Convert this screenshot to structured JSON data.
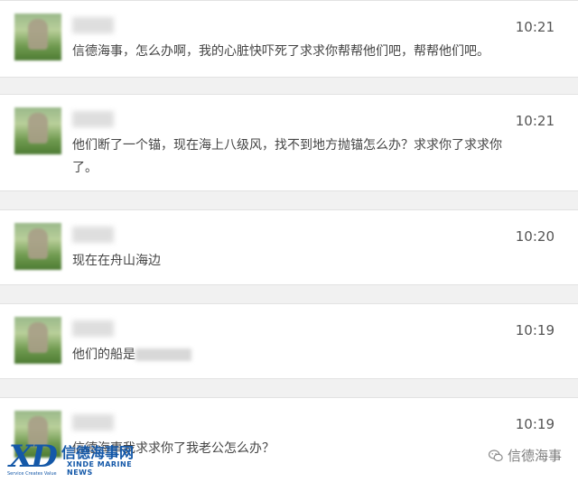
{
  "messages": [
    {
      "time": "10:21",
      "text": "信德海事，怎么办啊，我的心脏快吓死了求求你帮帮他们吧，帮帮他们吧。"
    },
    {
      "time": "10:21",
      "text": "他们断了一个锚，现在海上八级风，找不到地方抛锚怎么办？求求你了求求你了。"
    },
    {
      "time": "10:20",
      "text": "现在在舟山海边"
    },
    {
      "time": "10:19",
      "text": "他们的船是"
    },
    {
      "time": "10:19",
      "text": "信德海事我求求你了我老公怎么办？"
    }
  ],
  "logo": {
    "mark": "XD",
    "chinese": "信德海事网",
    "english": "XINDE MARINE NEWS",
    "tagline": "Service Creates Value"
  },
  "watermark": {
    "text": "信德海事"
  }
}
